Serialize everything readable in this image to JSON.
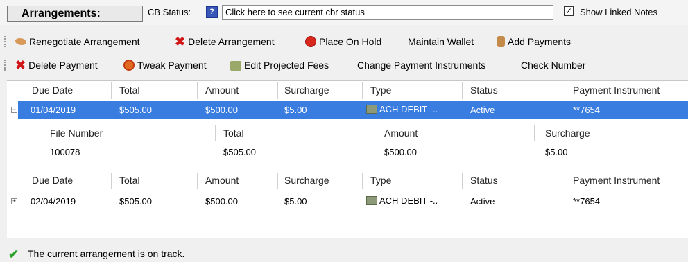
{
  "header": {
    "title": "Arrangements:",
    "cb_status_label": "CB Status:",
    "cb_status_field": "Click here to see current cbr status",
    "show_linked_notes_label": "Show Linked Notes",
    "show_linked_notes_checked": true
  },
  "toolbar1": {
    "renegotiate": "Renegotiate Arrangement",
    "delete_arrangement": "Delete Arrangement",
    "place_on_hold": "Place On Hold",
    "maintain_wallet": "Maintain Wallet",
    "add_payments": "Add Payments"
  },
  "toolbar2": {
    "delete_payment": "Delete Payment",
    "tweak_payment": "Tweak Payment",
    "edit_projected_fees": "Edit Projected Fees",
    "change_payment_instruments": "Change Payment Instruments",
    "check_number": "Check Number"
  },
  "grid": {
    "columns": [
      "Due Date",
      "Total",
      "Amount",
      "Surcharge",
      "Type",
      "Status",
      "Payment Instrument"
    ],
    "rows": [
      {
        "due_date": "01/04/2019",
        "total": "$505.00",
        "amount": "$500.00",
        "surcharge": "$5.00",
        "type": "ACH DEBIT -..",
        "status": "Active",
        "instrument": "**7654"
      },
      {
        "due_date": "02/04/2019",
        "total": "$505.00",
        "amount": "$500.00",
        "surcharge": "$5.00",
        "type": "ACH DEBIT -..",
        "status": "Active",
        "instrument": "**7654"
      }
    ],
    "sub_columns": [
      "File Number",
      "Total",
      "Amount",
      "Surcharge"
    ],
    "sub_row": {
      "file_number": "100078",
      "total": "$505.00",
      "amount": "$500.00",
      "surcharge": "$5.00"
    }
  },
  "status_bar": {
    "message": "The current arrangement is on track."
  },
  "colors": {
    "selection": "#3a7de0",
    "success": "#2aa02a",
    "danger": "#d01818"
  },
  "icons": {
    "renegotiate": "handshake-icon",
    "delete": "red-x-icon",
    "hold": "stop-icon",
    "add_payments": "money-bag-icon",
    "tweak": "tweak-icon",
    "fees": "fees-icon",
    "cb_status": "info-icon",
    "status_ok": "check-icon",
    "ach": "card-icon"
  }
}
